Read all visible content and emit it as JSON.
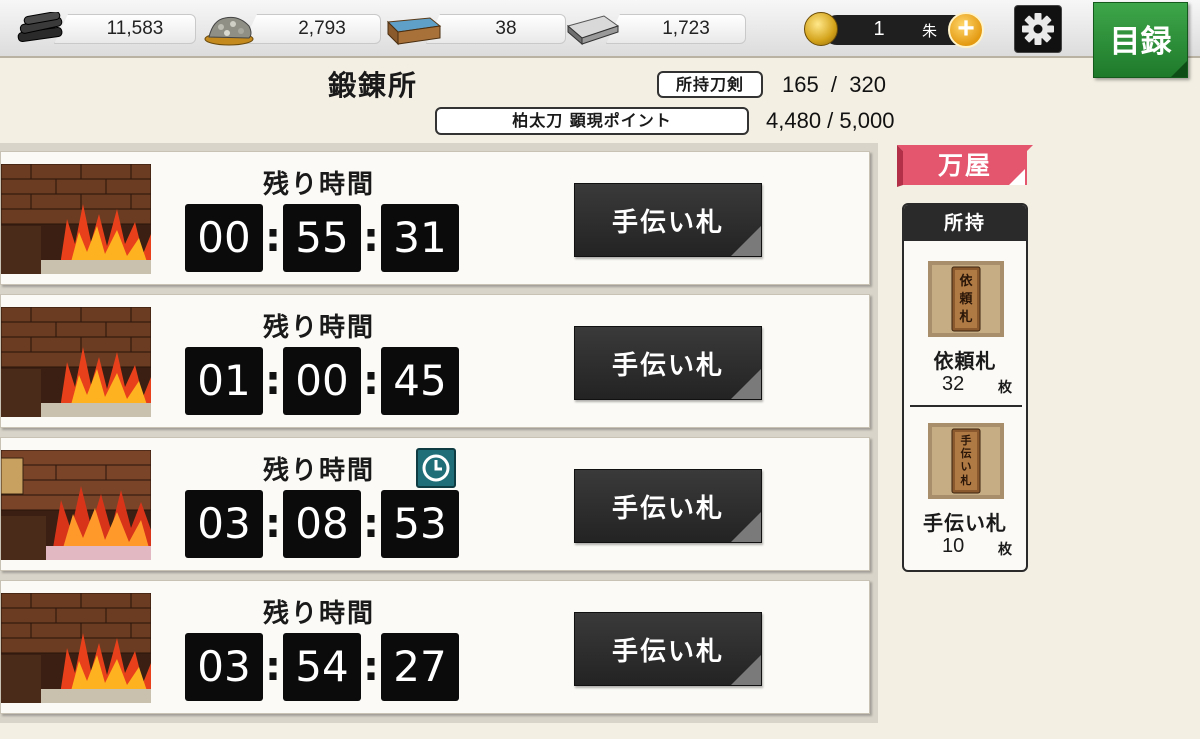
{
  "resources": [
    {
      "name": "charcoal",
      "icon": "charcoal-icon",
      "value": "11,583"
    },
    {
      "name": "tamahagane",
      "icon": "tamahagane-icon",
      "value": "2,793"
    },
    {
      "name": "cooling-water",
      "icon": "water-box-icon",
      "value": "38"
    },
    {
      "name": "whetstone",
      "icon": "whetstone-icon",
      "value": "1,723"
    }
  ],
  "koban": {
    "count": "1",
    "unit": "朱"
  },
  "menu_label": "目録",
  "page_title": "鍛錬所",
  "swords": {
    "label": "所持刀剣",
    "value": "165  /  320"
  },
  "points": {
    "label": "柏太刀 顕現ポイント",
    "value": "4,480 / 5,000"
  },
  "slots": [
    {
      "remain_label": "残り時間",
      "hh": "00",
      "mm": "55",
      "ss": "31",
      "button": "手伝い札",
      "clock": false
    },
    {
      "remain_label": "残り時間",
      "hh": "01",
      "mm": "00",
      "ss": "45",
      "button": "手伝い札",
      "clock": false
    },
    {
      "remain_label": "残り時間",
      "hh": "03",
      "mm": "08",
      "ss": "53",
      "button": "手伝い札",
      "clock": true
    },
    {
      "remain_label": "残り時間",
      "hh": "03",
      "mm": "54",
      "ss": "27",
      "button": "手伝い札",
      "clock": false
    }
  ],
  "shop": {
    "label": "万屋"
  },
  "owned": {
    "header": "所持",
    "items": [
      {
        "name": "依頼札",
        "count": "32",
        "unit": "枚",
        "card_text": "依頼札"
      },
      {
        "name": "手伝い札",
        "count": "10",
        "unit": "枚",
        "card_text": "手伝い札"
      }
    ]
  },
  "colors": {
    "menu_green": "#2a8e36",
    "shop_pink": "#e4556e",
    "clock_teal": "#1f6e78",
    "timer_black": "#0b0b0b"
  }
}
